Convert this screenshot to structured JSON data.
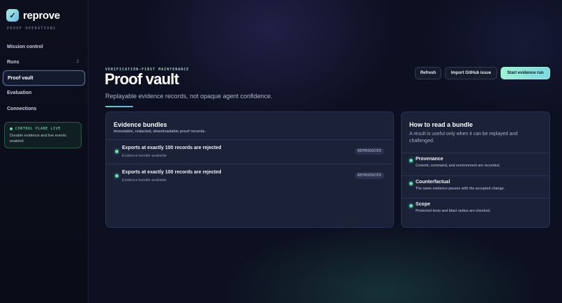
{
  "brand": {
    "name": "reprove",
    "subtitle": "PROOF OPERATIONS",
    "logo_icon": "check-icon"
  },
  "sidebar": {
    "items": [
      {
        "label": "Mission control",
        "badge": ""
      },
      {
        "label": "Runs",
        "badge": "2"
      },
      {
        "label": "Proof vault",
        "badge": "",
        "active": true
      },
      {
        "label": "Evaluation",
        "badge": ""
      },
      {
        "label": "Connections",
        "badge": ""
      }
    ],
    "status": {
      "title": "CONTROL PLANE LIVE",
      "text": "Durable evidence and live events enabled"
    }
  },
  "header": {
    "eyebrow": "VERIFICATION-FIRST MAINTENANCE",
    "title": "Proof vault",
    "subtitle": "Replayable evidence records, not opaque agent confidence."
  },
  "actions": {
    "refresh": "Refresh",
    "import": "Import GitHub issue",
    "start": "Start evidence run"
  },
  "evidence": {
    "title": "Evidence bundles",
    "subtitle": "Immutable, redacted, downloadable proof records.",
    "rows": [
      {
        "title": "Exports at exactly 100 records are rejected",
        "sub": "Evidence bundle available",
        "badge": "REPRODUCED"
      },
      {
        "title": "Exports at exactly 100 records are rejected",
        "sub": "Evidence bundle available",
        "badge": "REPRODUCED"
      }
    ]
  },
  "guide": {
    "title": "How to read a bundle",
    "intro": "A result is useful only when it can be replayed and challenged.",
    "items": [
      {
        "title": "Provenance",
        "sub": "Commit, command, and environment are recorded."
      },
      {
        "title": "Counterfactual",
        "sub": "The same evidence passes with the accepted change."
      },
      {
        "title": "Scope",
        "sub": "Protected tests and blast radius are checked."
      }
    ]
  },
  "colors": {
    "accent": "#5fe0a8",
    "primary_button": "#9ef0d4",
    "background": "#0d1020"
  }
}
